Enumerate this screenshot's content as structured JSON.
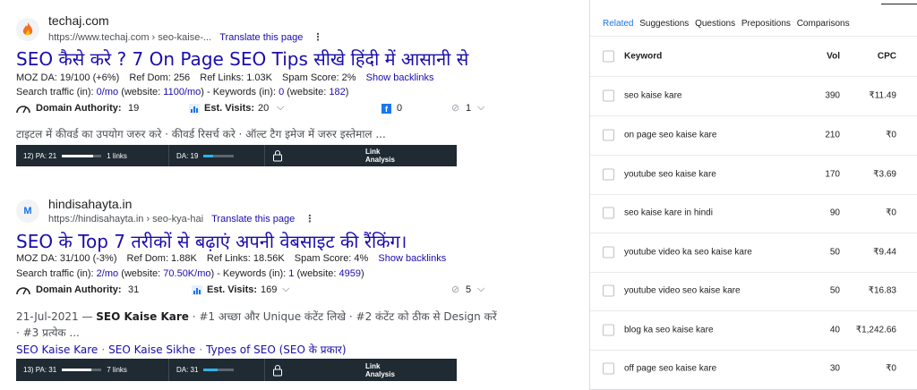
{
  "results": [
    {
      "site_name": "techaj.com",
      "url": "https://www.techaj.com › seo-kaise-...",
      "translate": "Translate this page",
      "title": "SEO कैसे करे ? 7 On Page SEO Tips सीखे हिंदी में आसानी से",
      "moz_da": "MOZ DA: 19/100 (+6%)",
      "ref_dom": "Ref Dom: 256",
      "ref_links": "Ref Links: 1.03K",
      "spam": "Spam Score: 2%",
      "show_backlinks": "Show backlinks",
      "traffic_prefix": "Search traffic (in): ",
      "traffic_in": "0/mo",
      "traffic_mid": " (website: ",
      "traffic_site": "1100/mo",
      "traffic_kw": ") - Keywords (in): ",
      "kw_in": "0",
      "kw_mid": " (website: ",
      "kw_site": "182",
      "kw_end": ")",
      "da_label": "Domain Authority:",
      "da_value": "19",
      "visits_label": "Est. Visits:",
      "visits_value": "20",
      "fb_count": "0",
      "link_count": "1",
      "snippet": "टाइटल में कीवर्ड का उपयोग जरुर करे · कीवर्ड रिसर्च करे · ऑल्ट टैग इमेज में जरुर इस्तेमाल ...",
      "bar_pa": "12) PA: 21",
      "bar_pa_fill": 0.8,
      "bar_links": "1 links",
      "bar_da": "DA: 19",
      "bar_da_fill": 0.3
    },
    {
      "site_name": "hindisahayta.in",
      "url": "https://hindisahayta.in › seo-kya-hai",
      "translate": "Translate this page",
      "title": "SEO के Top 7 तरीकों से बढ़ाएं अपनी वेबसाइट की रैंकिंग।",
      "moz_da": "MOZ DA: 31/100 (-3%)",
      "ref_dom": "Ref Dom: 1.88K",
      "ref_links": "Ref Links: 18.56K",
      "spam": "Spam Score: 4%",
      "show_backlinks": "Show backlinks",
      "traffic_prefix": "Search traffic (in): ",
      "traffic_in": "2/mo",
      "traffic_mid": " (website: ",
      "traffic_site": "70.50K/mo",
      "traffic_kw": ") - Keywords (in): ",
      "kw_in": "1",
      "kw_mid": " (website: ",
      "kw_site": "4959",
      "kw_end": ")",
      "da_label": "Domain Authority:",
      "da_value": "31",
      "visits_label": "Est. Visits:",
      "visits_value": "169",
      "link_count": "5",
      "snippet_date": "21-Jul-2021",
      "snippet_dash": " — ",
      "snippet_bold": "SEO Kaise Kare",
      "snippet_rest": " · #1 अच्छा और Unique कंटेंट लिखे · #2 कंटेंट को ठीक से Design करें",
      "snippet_line2": "· #3 प्रत्येक ...",
      "sitelinks": [
        "SEO Kaise Kare",
        "SEO Kaise Sikhe",
        "Types of SEO (SEO के प्रकार)"
      ],
      "bar_pa": "13) PA: 31",
      "bar_pa_fill": 0.75,
      "bar_links": "7 links",
      "bar_da": "DA: 31",
      "bar_da_fill": 0.45
    }
  ],
  "mozbar_link_analysis": "Link\nAnalysis",
  "mozbar_link": "Link",
  "mozbar_analysis": "Analysis",
  "panel": {
    "tabs": [
      {
        "label": "Related",
        "active": true
      },
      {
        "label": "Suggestions",
        "active": false
      },
      {
        "label": "Questions",
        "active": false
      },
      {
        "label": "Prepositions",
        "active": false
      },
      {
        "label": "Comparisons",
        "active": false
      }
    ],
    "header": {
      "keyword": "Keyword",
      "vol": "Vol",
      "cpc": "CPC"
    },
    "rows": [
      {
        "keyword": "seo kaise kare",
        "vol": "390",
        "cpc": "₹11.49"
      },
      {
        "keyword": "on page seo kaise kare",
        "vol": "210",
        "cpc": "₹0"
      },
      {
        "keyword": "youtube seo kaise kare",
        "vol": "170",
        "cpc": "₹3.69"
      },
      {
        "keyword": "seo kaise kare in hindi",
        "vol": "90",
        "cpc": "₹0"
      },
      {
        "keyword": "youtube video ka seo kaise kare",
        "vol": "50",
        "cpc": "₹9.44"
      },
      {
        "keyword": "youtube video seo kaise kare",
        "vol": "50",
        "cpc": "₹16.83"
      },
      {
        "keyword": "blog ka seo kaise kare",
        "vol": "40",
        "cpc": "₹1,242.66"
      },
      {
        "keyword": "off page seo kaise kare",
        "vol": "30",
        "cpc": "₹0"
      }
    ]
  },
  "colors": {
    "link": "#1a0dab",
    "tab_active": "#1a73e8",
    "mozbar_bg": "#1f2a33",
    "fb_blue": "#1877f2"
  }
}
